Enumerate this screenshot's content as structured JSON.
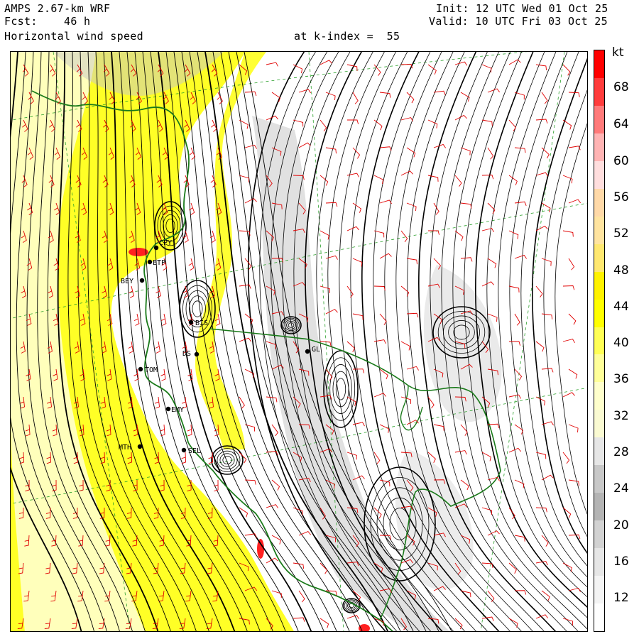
{
  "header": {
    "model": "AMPS 2.67-km WRF",
    "forecast_label": "Fcst:",
    "forecast_hours": "46 h",
    "field": "Horizontal wind speed",
    "level": "at k-index =  55",
    "init": "Init: 12 UTC Wed 01 Oct 25",
    "valid": "Valid: 10 UTC Fri 03 Oct 25"
  },
  "colorbar": {
    "unit": "kt",
    "labels": [
      "68",
      "64",
      "60",
      "56",
      "52",
      "48",
      "44",
      "40",
      "36",
      "32",
      "28",
      "24",
      "20",
      "16",
      "12"
    ],
    "colors": [
      "#ff0000",
      "#ff3c3c",
      "#ff7a7a",
      "#ffb4b4",
      "#ffdede",
      "#ffd9a8",
      "#ffe4a0",
      "#ffe870",
      "#fff200",
      "#ffff00",
      "#ffff55",
      "#ffff99",
      "#ffffcc",
      "#fafad2",
      "#e6e6e6",
      "#c8c8c8",
      "#b4b4b4",
      "#d2d2d2",
      "#e6e6e6",
      "#f4f4f4",
      "#ffffff"
    ]
  },
  "stations": [
    {
      "id": "CPY",
      "label": "CPY"
    },
    {
      "id": "ETP",
      "label": "ETP"
    },
    {
      "id": "BEY",
      "label": "BEY"
    },
    {
      "id": "BIS",
      "label": "BIS"
    },
    {
      "id": "DS",
      "label": "DS"
    },
    {
      "id": "TOM",
      "label": "TOM"
    },
    {
      "id": "MTH",
      "label": "MTH"
    },
    {
      "id": "EMY",
      "label": "EMY"
    },
    {
      "id": "SEL",
      "label": "SEL"
    },
    {
      "id": "GL",
      "label": "GL"
    }
  ],
  "colors": {
    "wind_barb": "#e00000",
    "coastline": "#1a7a1a",
    "grid": "#2aa02a",
    "streamline": "#000000",
    "shade_yellow": "#ffff00",
    "shade_grey": "#c8c8c8"
  }
}
